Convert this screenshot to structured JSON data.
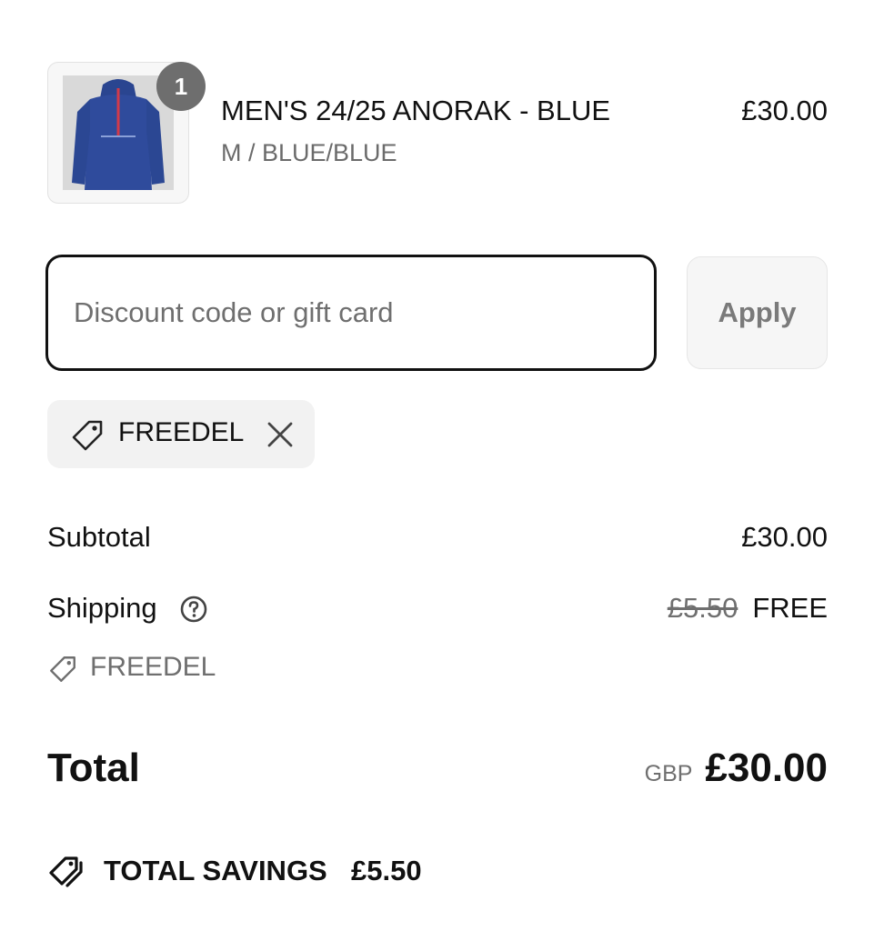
{
  "line_item": {
    "quantity": "1",
    "title": "MEN'S 24/25 ANORAK - BLUE",
    "variant": "M / BLUE/BLUE",
    "price": "£30.00",
    "image_icon": "anorak-jacket-image"
  },
  "discount": {
    "placeholder": "Discount code or gift card",
    "value": "",
    "apply_label": "Apply",
    "applied_code": "FREEDEL",
    "tag_icon": "tag-icon",
    "remove_icon": "close-icon"
  },
  "summary": {
    "subtotal_label": "Subtotal",
    "subtotal_value": "£30.00",
    "shipping_label": "Shipping",
    "shipping_help_icon": "question-circle-icon",
    "shipping_original": "£5.50",
    "shipping_value": "FREE",
    "shipping_discount_code": "FREEDEL",
    "total_label": "Total",
    "total_currency": "GBP",
    "total_value": "£30.00",
    "savings_label": "TOTAL SAVINGS",
    "savings_value": "£5.50",
    "savings_icon": "double-tag-icon"
  },
  "colors": {
    "text": "#111111",
    "muted": "#6f6f6f",
    "badge": "#6e6e6e",
    "jacket": "#2f4b9c",
    "zip": "#d23a4a"
  }
}
